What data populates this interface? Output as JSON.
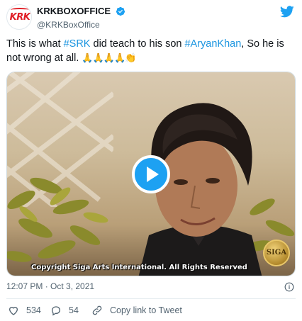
{
  "author": {
    "display_name": "KRKBOXOFFICE",
    "handle": "@KRKBoxOffice",
    "avatar_text": "KRK",
    "verified": true
  },
  "tweet": {
    "text_before": "This is what ",
    "hashtag_1": "#SRK",
    "text_middle": " did teach to his son ",
    "hashtag_2": "#AryanKhan",
    "text_after": ", So he is not wrong at all. ",
    "emojis": "🙏🙏🙏🙏👏"
  },
  "media": {
    "type": "video",
    "overlay_text": "Copyright Siga Arts International. All Rights Reserved",
    "seal_text": "SIGA"
  },
  "meta": {
    "timestamp": "12:07 PM · Oct 3, 2021"
  },
  "actions": {
    "like_count": "534",
    "reply_count": "54",
    "share_label": "Copy link to Tweet"
  },
  "colors": {
    "accent": "#1da1f2",
    "hashtag": "#1b95e0",
    "like": "#e0245e",
    "reply": "#1da1f2"
  },
  "icons": [
    "verified-badge-icon",
    "twitter-bird-icon",
    "play-icon",
    "info-icon",
    "heart-icon",
    "reply-icon",
    "link-icon"
  ]
}
